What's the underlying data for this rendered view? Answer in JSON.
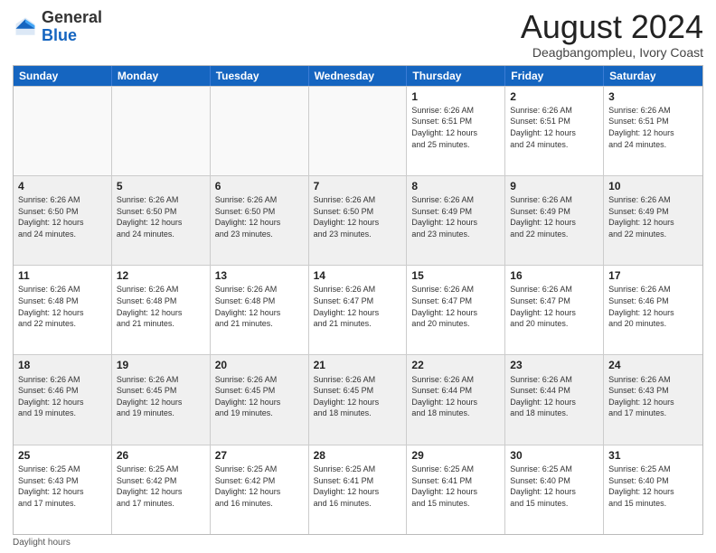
{
  "logo": {
    "text_general": "General",
    "text_blue": "Blue"
  },
  "header": {
    "month_year": "August 2024",
    "location": "Deagbangompleu, Ivory Coast"
  },
  "days_of_week": [
    "Sunday",
    "Monday",
    "Tuesday",
    "Wednesday",
    "Thursday",
    "Friday",
    "Saturday"
  ],
  "footer": {
    "label": "Daylight hours"
  },
  "weeks": [
    {
      "cells": [
        {
          "day": "",
          "info": "",
          "empty": true
        },
        {
          "day": "",
          "info": "",
          "empty": true
        },
        {
          "day": "",
          "info": "",
          "empty": true
        },
        {
          "day": "",
          "info": "",
          "empty": true
        },
        {
          "day": "1",
          "info": "Sunrise: 6:26 AM\nSunset: 6:51 PM\nDaylight: 12 hours\nand 25 minutes.",
          "empty": false
        },
        {
          "day": "2",
          "info": "Sunrise: 6:26 AM\nSunset: 6:51 PM\nDaylight: 12 hours\nand 24 minutes.",
          "empty": false
        },
        {
          "day": "3",
          "info": "Sunrise: 6:26 AM\nSunset: 6:51 PM\nDaylight: 12 hours\nand 24 minutes.",
          "empty": false
        }
      ]
    },
    {
      "cells": [
        {
          "day": "4",
          "info": "Sunrise: 6:26 AM\nSunset: 6:50 PM\nDaylight: 12 hours\nand 24 minutes.",
          "empty": false
        },
        {
          "day": "5",
          "info": "Sunrise: 6:26 AM\nSunset: 6:50 PM\nDaylight: 12 hours\nand 24 minutes.",
          "empty": false
        },
        {
          "day": "6",
          "info": "Sunrise: 6:26 AM\nSunset: 6:50 PM\nDaylight: 12 hours\nand 23 minutes.",
          "empty": false
        },
        {
          "day": "7",
          "info": "Sunrise: 6:26 AM\nSunset: 6:50 PM\nDaylight: 12 hours\nand 23 minutes.",
          "empty": false
        },
        {
          "day": "8",
          "info": "Sunrise: 6:26 AM\nSunset: 6:49 PM\nDaylight: 12 hours\nand 23 minutes.",
          "empty": false
        },
        {
          "day": "9",
          "info": "Sunrise: 6:26 AM\nSunset: 6:49 PM\nDaylight: 12 hours\nand 22 minutes.",
          "empty": false
        },
        {
          "day": "10",
          "info": "Sunrise: 6:26 AM\nSunset: 6:49 PM\nDaylight: 12 hours\nand 22 minutes.",
          "empty": false
        }
      ]
    },
    {
      "cells": [
        {
          "day": "11",
          "info": "Sunrise: 6:26 AM\nSunset: 6:48 PM\nDaylight: 12 hours\nand 22 minutes.",
          "empty": false
        },
        {
          "day": "12",
          "info": "Sunrise: 6:26 AM\nSunset: 6:48 PM\nDaylight: 12 hours\nand 21 minutes.",
          "empty": false
        },
        {
          "day": "13",
          "info": "Sunrise: 6:26 AM\nSunset: 6:48 PM\nDaylight: 12 hours\nand 21 minutes.",
          "empty": false
        },
        {
          "day": "14",
          "info": "Sunrise: 6:26 AM\nSunset: 6:47 PM\nDaylight: 12 hours\nand 21 minutes.",
          "empty": false
        },
        {
          "day": "15",
          "info": "Sunrise: 6:26 AM\nSunset: 6:47 PM\nDaylight: 12 hours\nand 20 minutes.",
          "empty": false
        },
        {
          "day": "16",
          "info": "Sunrise: 6:26 AM\nSunset: 6:47 PM\nDaylight: 12 hours\nand 20 minutes.",
          "empty": false
        },
        {
          "day": "17",
          "info": "Sunrise: 6:26 AM\nSunset: 6:46 PM\nDaylight: 12 hours\nand 20 minutes.",
          "empty": false
        }
      ]
    },
    {
      "cells": [
        {
          "day": "18",
          "info": "Sunrise: 6:26 AM\nSunset: 6:46 PM\nDaylight: 12 hours\nand 19 minutes.",
          "empty": false
        },
        {
          "day": "19",
          "info": "Sunrise: 6:26 AM\nSunset: 6:45 PM\nDaylight: 12 hours\nand 19 minutes.",
          "empty": false
        },
        {
          "day": "20",
          "info": "Sunrise: 6:26 AM\nSunset: 6:45 PM\nDaylight: 12 hours\nand 19 minutes.",
          "empty": false
        },
        {
          "day": "21",
          "info": "Sunrise: 6:26 AM\nSunset: 6:45 PM\nDaylight: 12 hours\nand 18 minutes.",
          "empty": false
        },
        {
          "day": "22",
          "info": "Sunrise: 6:26 AM\nSunset: 6:44 PM\nDaylight: 12 hours\nand 18 minutes.",
          "empty": false
        },
        {
          "day": "23",
          "info": "Sunrise: 6:26 AM\nSunset: 6:44 PM\nDaylight: 12 hours\nand 18 minutes.",
          "empty": false
        },
        {
          "day": "24",
          "info": "Sunrise: 6:26 AM\nSunset: 6:43 PM\nDaylight: 12 hours\nand 17 minutes.",
          "empty": false
        }
      ]
    },
    {
      "cells": [
        {
          "day": "25",
          "info": "Sunrise: 6:25 AM\nSunset: 6:43 PM\nDaylight: 12 hours\nand 17 minutes.",
          "empty": false
        },
        {
          "day": "26",
          "info": "Sunrise: 6:25 AM\nSunset: 6:42 PM\nDaylight: 12 hours\nand 17 minutes.",
          "empty": false
        },
        {
          "day": "27",
          "info": "Sunrise: 6:25 AM\nSunset: 6:42 PM\nDaylight: 12 hours\nand 16 minutes.",
          "empty": false
        },
        {
          "day": "28",
          "info": "Sunrise: 6:25 AM\nSunset: 6:41 PM\nDaylight: 12 hours\nand 16 minutes.",
          "empty": false
        },
        {
          "day": "29",
          "info": "Sunrise: 6:25 AM\nSunset: 6:41 PM\nDaylight: 12 hours\nand 15 minutes.",
          "empty": false
        },
        {
          "day": "30",
          "info": "Sunrise: 6:25 AM\nSunset: 6:40 PM\nDaylight: 12 hours\nand 15 minutes.",
          "empty": false
        },
        {
          "day": "31",
          "info": "Sunrise: 6:25 AM\nSunset: 6:40 PM\nDaylight: 12 hours\nand 15 minutes.",
          "empty": false
        }
      ]
    }
  ]
}
